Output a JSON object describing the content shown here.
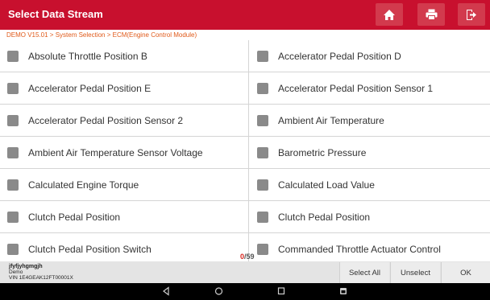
{
  "header": {
    "title": "Select Data Stream",
    "icons": [
      "home-icon",
      "print-icon",
      "exit-icon"
    ]
  },
  "breadcrumb": "DEMO V15.01 > System Selection > ECM(Engine Control Module)",
  "items": [
    [
      "Absolute Throttle Position B",
      "Accelerator Pedal Position D"
    ],
    [
      "Accelerator Pedal Position E",
      "Accelerator Pedal Position Sensor 1"
    ],
    [
      "Accelerator Pedal Position Sensor 2",
      "Ambient Air Temperature"
    ],
    [
      "Ambient Air Temperature Sensor Voltage",
      "Barometric Pressure"
    ],
    [
      "Calculated Engine Torque",
      "Calculated Load Value"
    ],
    [
      "Clutch Pedal Position",
      "Clutch Pedal Position"
    ],
    [
      "Clutch Pedal Position Switch",
      "Commanded Throttle Actuator Control"
    ]
  ],
  "counter": {
    "selected": "0",
    "separator": "/",
    "total": "59"
  },
  "footer": {
    "user": "jfyfjyhgmgjh",
    "mode": "Demo",
    "vin": "VIN 1E4GEAK12FT00001X",
    "buttons": {
      "select_all": "Select All",
      "unselect": "Unselect",
      "ok": "OK"
    }
  },
  "colors": {
    "titlebar": "#c8102e",
    "breadcrumb": "#e05a1a",
    "checkbox": "#8a8a8a",
    "counter_selected": "#d9251d"
  },
  "navbar": {
    "icons": [
      "back-icon",
      "home-circle-icon",
      "recents-icon",
      "screenshot-icon"
    ]
  }
}
